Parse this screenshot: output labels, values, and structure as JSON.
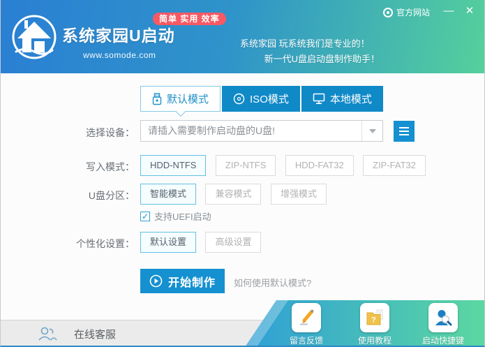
{
  "window": {
    "minimize_glyph": "—",
    "close_glyph": "✕"
  },
  "header": {
    "app_title": "系统家园U启动",
    "website": "www.somode.com",
    "badge": "简单 实用 效率",
    "slogan_line1": "系统家园 玩系统我们是专业的！",
    "slogan_line2": "新一代U盘启动盘制作助手！",
    "official_site": "官方网站"
  },
  "tabs": [
    {
      "label": "默认模式",
      "active": true
    },
    {
      "label": "ISO模式",
      "active": false
    },
    {
      "label": "本地模式",
      "active": false
    }
  ],
  "form": {
    "device_label": "选择设备：",
    "device_placeholder": "请插入需要制作启动盘的U盘!",
    "write_mode_label": "写入模式：",
    "write_modes": [
      "HDD-NTFS",
      "ZIP-NTFS",
      "HDD-FAT32",
      "ZIP-FAT32"
    ],
    "write_mode_selected": "HDD-NTFS",
    "partition_label": "U盘分区：",
    "partition_modes": [
      "智能模式",
      "兼容模式",
      "增强模式"
    ],
    "partition_selected": "智能模式",
    "uefi_check_glyph": "✓",
    "uefi_label": "支持UEFI启动",
    "personalize_label": "个性化设置：",
    "personalize_modes": [
      "默认设置",
      "高级设置"
    ],
    "personalize_selected": "默认设置",
    "start_button": "开始制作",
    "help_link": "如何使用默认模式?"
  },
  "footer": {
    "online_service": "在线客服",
    "shortcuts": [
      "留言反馈",
      "使用教程",
      "启动快捷键"
    ]
  },
  "colors": {
    "header_gradient_left": "#2a7fd3",
    "header_gradient_right": "#55d09c",
    "tab_blue": "#1089c7",
    "accent_blue": "#1590d0",
    "selected_border": "#62bfe2",
    "badge_red": "#f75964",
    "footer_gray": "#ebebeb"
  }
}
